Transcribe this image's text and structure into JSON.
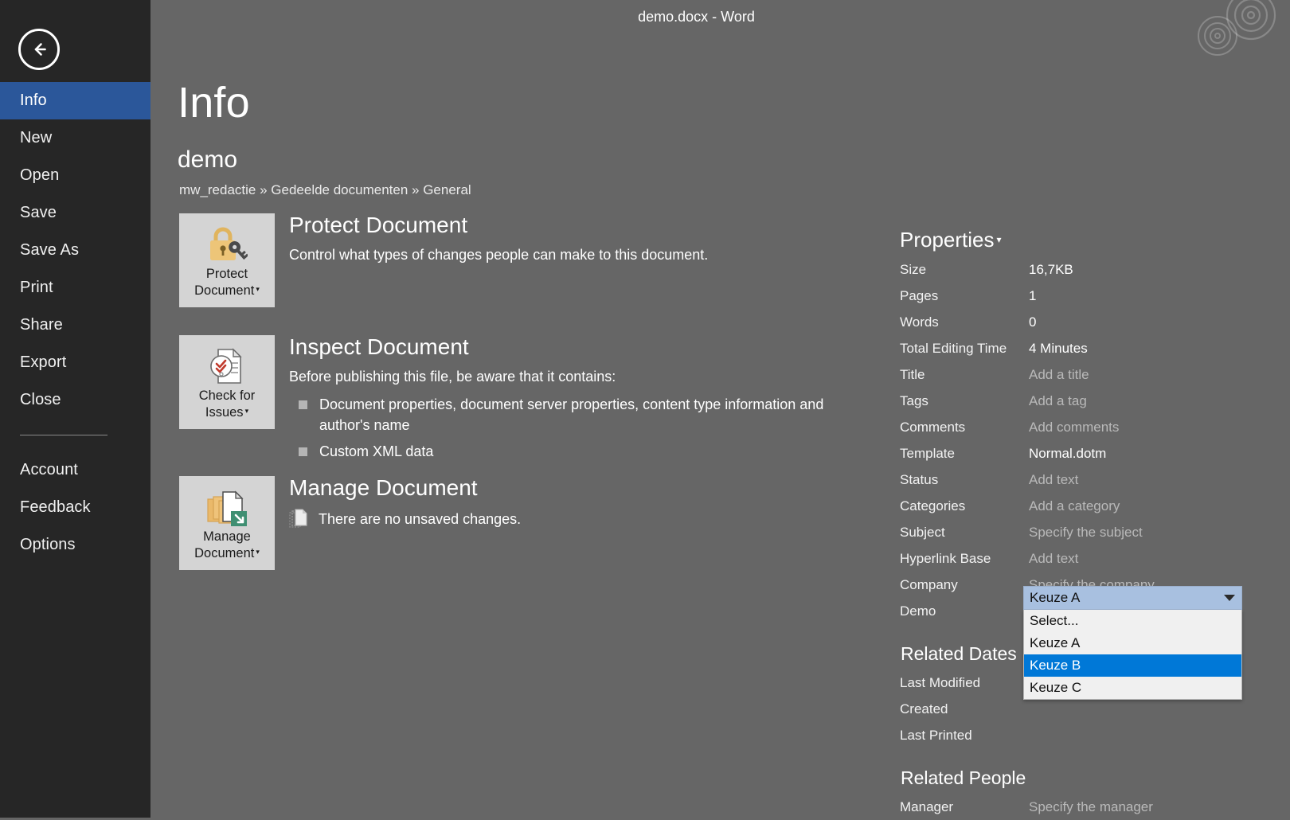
{
  "window": {
    "title": "demo.docx  -  Word"
  },
  "sidebar": {
    "back_icon": "back-arrow-icon",
    "items": [
      {
        "label": "Info",
        "active": true
      },
      {
        "label": "New",
        "active": false
      },
      {
        "label": "Open",
        "active": false
      },
      {
        "label": "Save",
        "active": false
      },
      {
        "label": "Save As",
        "active": false
      },
      {
        "label": "Print",
        "active": false
      },
      {
        "label": "Share",
        "active": false
      },
      {
        "label": "Export",
        "active": false
      },
      {
        "label": "Close",
        "active": false
      }
    ],
    "secondary_items": [
      {
        "label": "Account"
      },
      {
        "label": "Feedback"
      },
      {
        "label": "Options"
      }
    ]
  },
  "page": {
    "title": "Info",
    "doc_name": "demo",
    "breadcrumb": "mw_redactie » Gedeelde  documenten » General"
  },
  "blocks": {
    "protect": {
      "button_label_line1": "Protect",
      "button_label_line2": "Document",
      "icon": "lock-and-key-icon",
      "title": "Protect Document",
      "desc": "Control what types of changes people can make to this document."
    },
    "inspect": {
      "button_label_line1": "Check for",
      "button_label_line2": "Issues",
      "icon": "document-inspect-icon",
      "title": "Inspect Document",
      "desc": "Before publishing this file, be aware that it contains:",
      "items": [
        "Document properties, document server properties, content type information and author's name",
        "Custom XML data"
      ]
    },
    "manage": {
      "button_label_line1": "Manage",
      "button_label_line2": "Document",
      "icon": "manage-versions-icon",
      "title": "Manage Document",
      "status": "There are no unsaved changes.",
      "status_icon": "versions-icon"
    }
  },
  "properties": {
    "header": "Properties",
    "rows": [
      {
        "label": "Size",
        "value": "16,7KB",
        "placeholder": false
      },
      {
        "label": "Pages",
        "value": "1",
        "placeholder": false
      },
      {
        "label": "Words",
        "value": "0",
        "placeholder": false
      },
      {
        "label": "Total Editing Time",
        "value": "4 Minutes",
        "placeholder": false
      },
      {
        "label": "Title",
        "value": "Add a title",
        "placeholder": true
      },
      {
        "label": "Tags",
        "value": "Add a tag",
        "placeholder": true
      },
      {
        "label": "Comments",
        "value": "Add comments",
        "placeholder": true
      },
      {
        "label": "Template",
        "value": "Normal.dotm",
        "placeholder": false
      },
      {
        "label": "Status",
        "value": "Add text",
        "placeholder": true
      },
      {
        "label": "Categories",
        "value": "Add a category",
        "placeholder": true
      },
      {
        "label": "Subject",
        "value": "Specify the subject",
        "placeholder": true
      },
      {
        "label": "Hyperlink Base",
        "value": "Add text",
        "placeholder": true
      },
      {
        "label": "Company",
        "value": "Specify the company",
        "placeholder": true
      },
      {
        "label": "Demo",
        "value": "",
        "placeholder": false
      }
    ],
    "related_dates": {
      "heading": "Related Dates",
      "rows": [
        {
          "label": "Last Modified",
          "value": ""
        },
        {
          "label": "Created",
          "value": ""
        },
        {
          "label": "Last Printed",
          "value": ""
        }
      ]
    },
    "related_people": {
      "heading": "Related People",
      "rows": [
        {
          "label": "Manager",
          "value": "Specify the manager",
          "placeholder": true
        }
      ]
    }
  },
  "demo_combo": {
    "selected": "Keuze A",
    "options": [
      {
        "label": "Select...",
        "highlighted": false
      },
      {
        "label": "Keuze A",
        "highlighted": false
      },
      {
        "label": "Keuze B",
        "highlighted": true
      },
      {
        "label": "Keuze C",
        "highlighted": false
      }
    ]
  },
  "colors": {
    "backstage_bg": "#666666",
    "sidebar_bg": "#262626",
    "accent": "#2b579a",
    "button_face": "#d4d4d4",
    "combo_closed_bg": "#a8c0e0",
    "combo_highlight": "#0078d7"
  }
}
